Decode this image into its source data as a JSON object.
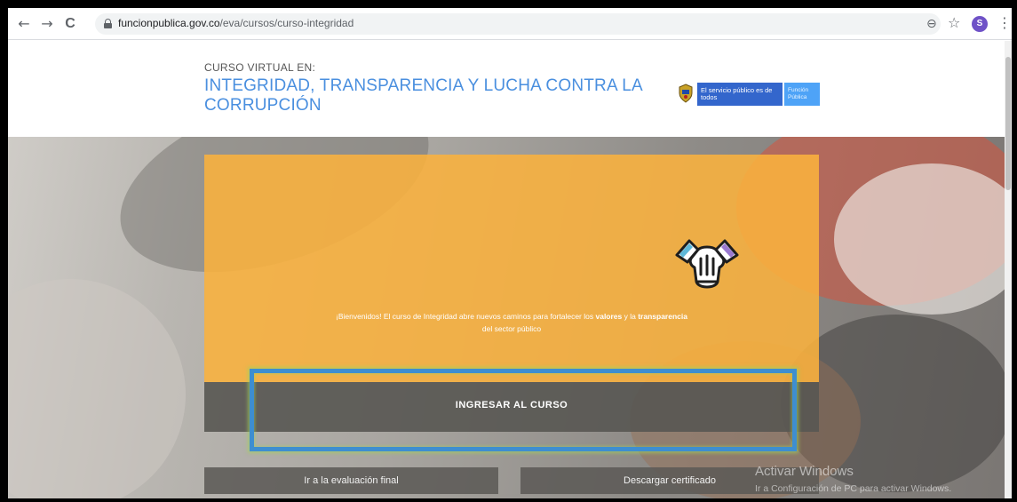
{
  "browser": {
    "url_domain": "funcionpublica.gov.co",
    "url_path": "/eva/cursos/curso-integridad",
    "back_icon": "←",
    "forward_icon": "→",
    "reload_icon": "C",
    "zoom_icon": "⊖",
    "star_icon": "☆",
    "menu_icon": "⋮",
    "profile_initial": "S",
    "profile_color": "#6f52c7"
  },
  "header": {
    "kicker": "CURSO VIRTUAL EN:",
    "title": "INTEGRIDAD, TRANSPARENCIA Y LUCHA CONTRA LA CORRUPCIÓN",
    "title_color": "#4a8fdf",
    "logo_primary": "El servicio público es de todos",
    "logo_secondary": "Función Pública"
  },
  "hero": {
    "welcome_pre": "¡Bienvenidos! El curso de Integridad abre nuevos caminos para fortalecer los ",
    "welcome_bold1": "valores",
    "welcome_mid": " y la ",
    "welcome_bold2": "transparencia",
    "welcome_post": " del sector público",
    "enter_button": "INGRESAR AL CURSO",
    "final_eval_button": "Ir a la evaluación final",
    "certificate_button": "Descargar certificado",
    "panel_color": "#fab23d",
    "highlight_color": "#3e8ed0"
  },
  "watermark": {
    "title": "Activar Windows",
    "subtitle": "Ir a Configuración de PC para activar Windows."
  }
}
